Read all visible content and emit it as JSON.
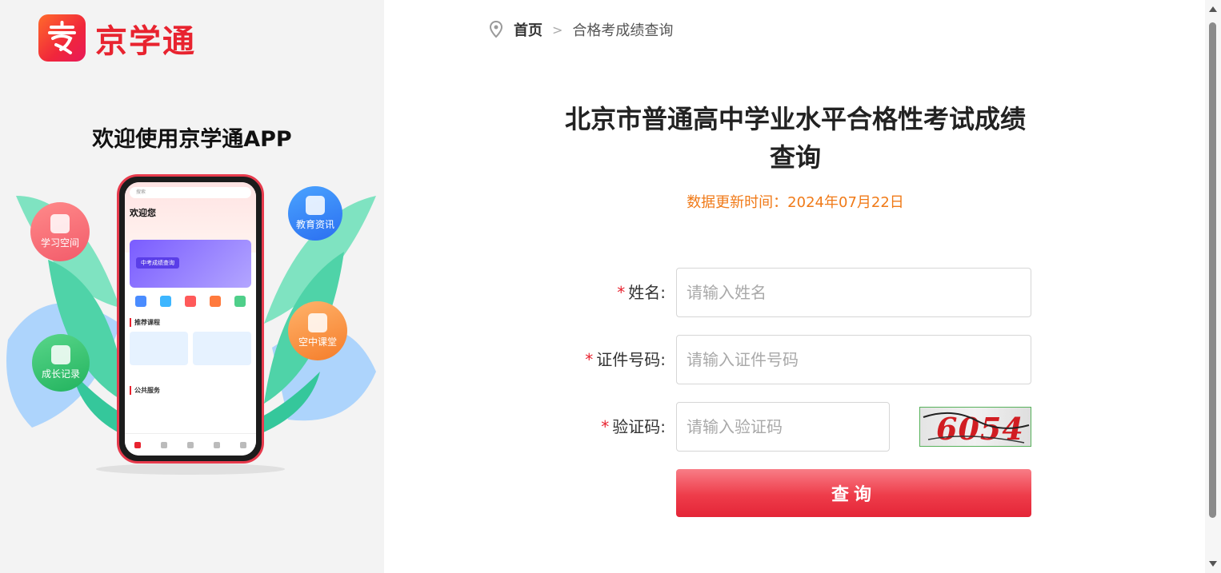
{
  "brand": {
    "name": "京学通",
    "icon": "jingxuetong-logo-icon",
    "accent": "#e8232f"
  },
  "left": {
    "welcome": "欢迎使用京学通APP",
    "bubbles": [
      {
        "label": "学习空间",
        "icon": "study-space-icon"
      },
      {
        "label": "教育资讯",
        "icon": "news-icon"
      },
      {
        "label": "空中课堂",
        "icon": "classroom-icon"
      },
      {
        "label": "成长记录",
        "icon": "growth-record-icon"
      }
    ],
    "phone": {
      "search": "搜索",
      "welcome": "欢迎您",
      "banner": "中考成绩查询",
      "section1": "推荐课程",
      "section2": "公共服务"
    }
  },
  "breadcrumb": {
    "home": "首页",
    "separator": ">",
    "current": "合格考成绩查询"
  },
  "page": {
    "title_line1": "北京市普通高中学业水平合格性考试成绩",
    "title_line2": "查询",
    "update_time": "数据更新时间：2024年07月22日"
  },
  "form": {
    "required_mark": "*",
    "name": {
      "label": "姓名:",
      "placeholder": "请输入姓名"
    },
    "id": {
      "label": "证件号码:",
      "placeholder": "请输入证件号码"
    },
    "captcha": {
      "label": "验证码:",
      "placeholder": "请输入验证码",
      "image_text": "6054"
    },
    "submit": "查询"
  },
  "colors": {
    "accent": "#e8232f",
    "update_time": "#f07a18",
    "captcha_border": "#56b15a"
  }
}
